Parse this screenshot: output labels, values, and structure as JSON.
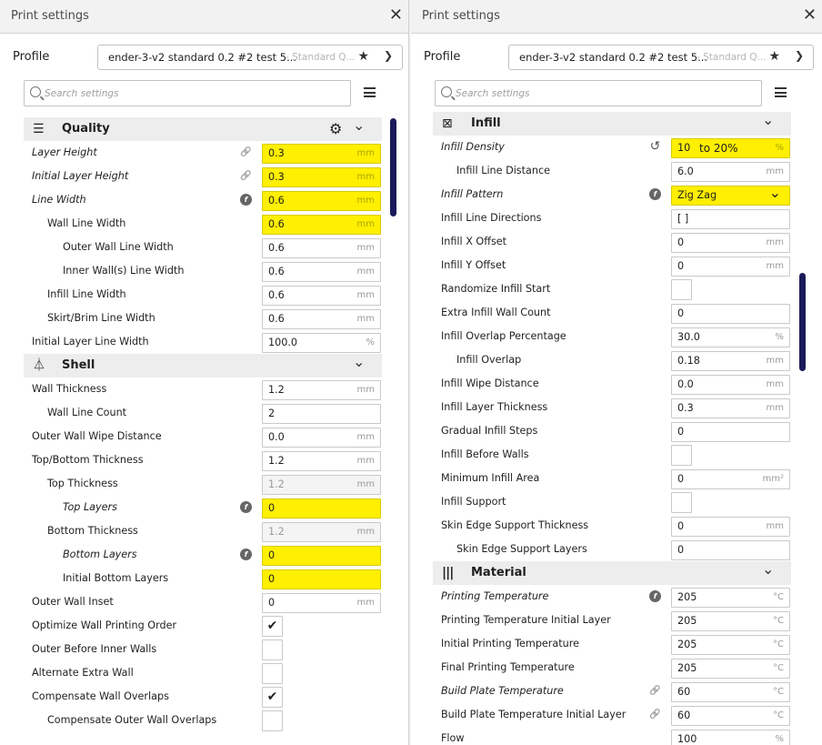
{
  "left": {
    "title": "Print settings",
    "profile_label": "Profile",
    "profile_name": "ender-3-v2 standard 0.2 #2 test 5...",
    "profile_sub": "- Standard Q...",
    "search_placeholder": "Search settings",
    "cat_quality": "Quality",
    "cat_shell": "Shell",
    "rows": {
      "layer_height": {
        "label": "Layer Height",
        "value": "0.3",
        "unit": "mm"
      },
      "initial_layer_height": {
        "label": "Initial Layer Height",
        "value": "0.3",
        "unit": "mm"
      },
      "line_width": {
        "label": "Line Width",
        "value": "0.6",
        "unit": "mm"
      },
      "wall_line_width": {
        "label": "Wall Line Width",
        "value": "0.6",
        "unit": "mm"
      },
      "outer_wall_line_width": {
        "label": "Outer Wall Line Width",
        "value": "0.6",
        "unit": "mm"
      },
      "inner_wall_line_width": {
        "label": "Inner Wall(s) Line Width",
        "value": "0.6",
        "unit": "mm"
      },
      "infill_line_width": {
        "label": "Infill Line Width",
        "value": "0.6",
        "unit": "mm"
      },
      "skirt_line_width": {
        "label": "Skirt/Brim Line Width",
        "value": "0.6",
        "unit": "mm"
      },
      "initial_layer_line_width": {
        "label": "Initial Layer Line Width",
        "value": "100.0",
        "unit": "%"
      },
      "wall_thickness": {
        "label": "Wall Thickness",
        "value": "1.2",
        "unit": "mm"
      },
      "wall_line_count": {
        "label": "Wall Line Count",
        "value": "2",
        "unit": ""
      },
      "outer_wall_wipe": {
        "label": "Outer Wall Wipe Distance",
        "value": "0.0",
        "unit": "mm"
      },
      "top_bottom_thickness": {
        "label": "Top/Bottom Thickness",
        "value": "1.2",
        "unit": "mm"
      },
      "top_thickness": {
        "label": "Top Thickness",
        "value": "1.2",
        "unit": "mm"
      },
      "top_layers": {
        "label": "Top Layers",
        "value": "0",
        "unit": ""
      },
      "bottom_thickness": {
        "label": "Bottom Thickness",
        "value": "1.2",
        "unit": "mm"
      },
      "bottom_layers": {
        "label": "Bottom Layers",
        "value": "0",
        "unit": ""
      },
      "initial_bottom_layers": {
        "label": "Initial Bottom Layers",
        "value": "0",
        "unit": ""
      },
      "outer_wall_inset": {
        "label": "Outer Wall Inset",
        "value": "0",
        "unit": "mm"
      },
      "optimize_wall_order": {
        "label": "Optimize Wall Printing Order",
        "check": "✔"
      },
      "outer_before_inner": {
        "label": "Outer Before Inner Walls",
        "check": ""
      },
      "alternate_extra_wall": {
        "label": "Alternate Extra Wall",
        "check": ""
      },
      "compensate_wall_overlaps": {
        "label": "Compensate Wall Overlaps",
        "check": "✔"
      },
      "compensate_outer_wall_overlaps": {
        "label": "Compensate Outer Wall Overlaps",
        "check": ""
      }
    }
  },
  "right": {
    "title": "Print settings",
    "profile_label": "Profile",
    "profile_name": "ender-3-v2 standard 0.2 #2 test 5...",
    "profile_sub": "- Standard Q...",
    "search_placeholder": "Search settings",
    "cat_infill": "Infill",
    "cat_material": "Material",
    "rows": {
      "infill_density": {
        "label": "Infill Density",
        "value": "10",
        "extra": "to 20%",
        "unit": "%"
      },
      "infill_line_distance": {
        "label": "Infill Line Distance",
        "value": "6.0",
        "unit": "mm"
      },
      "infill_pattern": {
        "label": "Infill Pattern",
        "value": "Zig Zag"
      },
      "infill_line_directions": {
        "label": "Infill Line Directions",
        "value": "[ ]",
        "unit": ""
      },
      "infill_x_offset": {
        "label": "Infill X Offset",
        "value": "0",
        "unit": "mm"
      },
      "infill_y_offset": {
        "label": "Infill Y Offset",
        "value": "0",
        "unit": "mm"
      },
      "randomize_infill_start": {
        "label": "Randomize Infill Start",
        "check": ""
      },
      "extra_infill_wall_count": {
        "label": "Extra Infill Wall Count",
        "value": "0",
        "unit": ""
      },
      "infill_overlap_pct": {
        "label": "Infill Overlap Percentage",
        "value": "30.0",
        "unit": "%"
      },
      "infill_overlap": {
        "label": "Infill Overlap",
        "value": "0.18",
        "unit": "mm"
      },
      "infill_wipe_distance": {
        "label": "Infill Wipe Distance",
        "value": "0.0",
        "unit": "mm"
      },
      "infill_layer_thickness": {
        "label": "Infill Layer Thickness",
        "value": "0.3",
        "unit": "mm"
      },
      "gradual_infill_steps": {
        "label": "Gradual Infill Steps",
        "value": "0",
        "unit": ""
      },
      "infill_before_walls": {
        "label": "Infill Before Walls",
        "check": ""
      },
      "min_infill_area": {
        "label": "Minimum Infill Area",
        "value": "0",
        "unit": "mm²"
      },
      "infill_support": {
        "label": "Infill Support",
        "check": ""
      },
      "skin_edge_support_thickness": {
        "label": "Skin Edge Support Thickness",
        "value": "0",
        "unit": "mm"
      },
      "skin_edge_support_layers": {
        "label": "Skin Edge Support Layers",
        "value": "0",
        "unit": ""
      },
      "printing_temperature": {
        "label": "Printing Temperature",
        "value": "205",
        "unit": "°C"
      },
      "printing_temperature_initial": {
        "label": "Printing Temperature Initial Layer",
        "value": "205",
        "unit": "°C"
      },
      "initial_printing_temperature": {
        "label": "Initial Printing Temperature",
        "value": "205",
        "unit": "°C"
      },
      "final_printing_temperature": {
        "label": "Final Printing Temperature",
        "value": "205",
        "unit": "°C"
      },
      "build_plate_temperature": {
        "label": "Build Plate Temperature",
        "value": "60",
        "unit": "°C"
      },
      "build_plate_temperature_initial": {
        "label": "Build Plate Temperature Initial Layer",
        "value": "60",
        "unit": "°C"
      },
      "flow": {
        "label": "Flow",
        "value": "100",
        "unit": "%"
      }
    }
  },
  "icons": {
    "close": "close-icon",
    "star": "star-icon",
    "chevron": "chevron-down-icon",
    "search": "search-icon",
    "menu": "menu-icon",
    "gear": "gear-icon",
    "link": "link-icon",
    "function": "function-icon",
    "reset": "reset-icon",
    "quality": "quality-icon",
    "shell": "shell-icon",
    "infill": "infill-icon",
    "material": "material-icon"
  },
  "colors": {
    "highlight": "#ffef00",
    "scrollbar": "#1a1a5a",
    "category_bg": "#ededed"
  }
}
